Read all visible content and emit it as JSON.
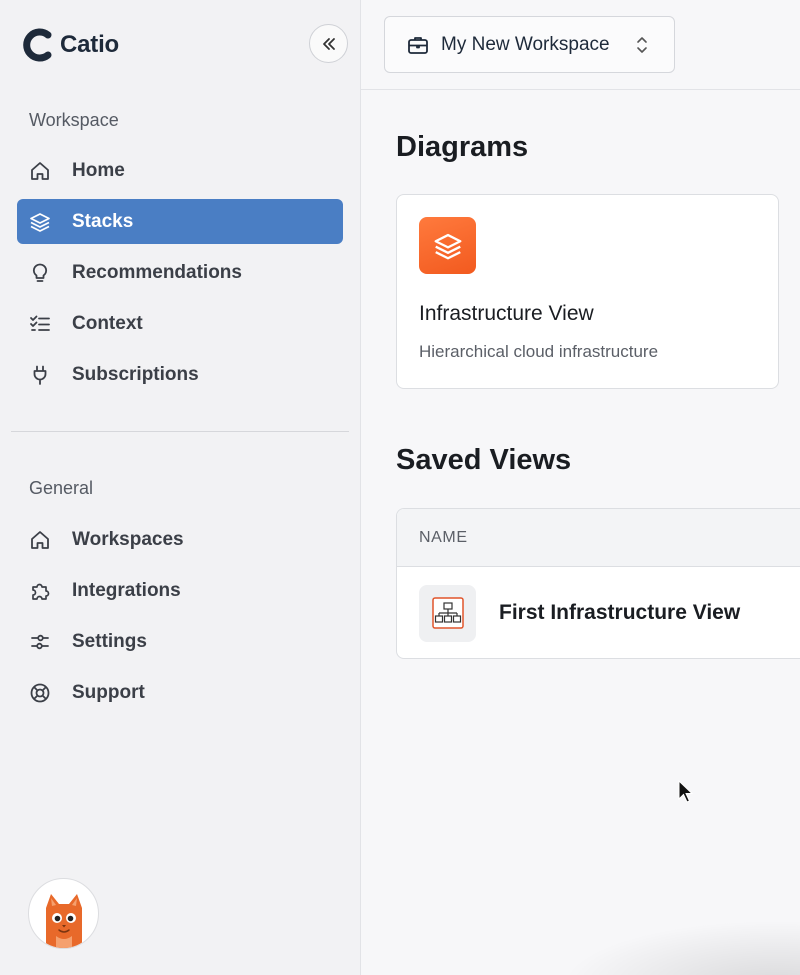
{
  "app": {
    "name": "Catio"
  },
  "sidebar": {
    "collapse_icon": "double-chevron-left-icon",
    "workspace_section": "Workspace",
    "workspace_items": [
      {
        "label": "Home",
        "icon": "home-icon",
        "active": false
      },
      {
        "label": "Stacks",
        "icon": "layers-icon",
        "active": true
      },
      {
        "label": "Recommendations",
        "icon": "lightbulb-icon",
        "active": false
      },
      {
        "label": "Context",
        "icon": "checklist-icon",
        "active": false
      },
      {
        "label": "Subscriptions",
        "icon": "plug-icon",
        "active": false
      }
    ],
    "general_section": "General",
    "general_items": [
      {
        "label": "Workspaces",
        "icon": "home-icon"
      },
      {
        "label": "Integrations",
        "icon": "puzzle-icon"
      },
      {
        "label": "Settings",
        "icon": "sliders-icon"
      },
      {
        "label": "Support",
        "icon": "lifebuoy-icon"
      }
    ],
    "avatar_icon": "cat-avatar-icon"
  },
  "header": {
    "workspace_selector": {
      "label": "My New Workspace",
      "icon": "briefcase-icon",
      "chevron": "chevron-updown-icon"
    }
  },
  "main": {
    "diagrams_title": "Diagrams",
    "diagram_card": {
      "title": "Infrastructure View",
      "subtitle": "Hierarchical cloud infrastructure",
      "icon": "layers-icon"
    },
    "saved_views_title": "Saved Views",
    "table": {
      "columns": [
        "NAME"
      ],
      "rows": [
        {
          "name": "First Infrastructure View",
          "icon": "hierarchy-diagram-icon"
        }
      ]
    }
  },
  "colors": {
    "accent": "#4a7ec4",
    "brand_orange": "#f2642a",
    "logo": "#1e2a3a"
  }
}
